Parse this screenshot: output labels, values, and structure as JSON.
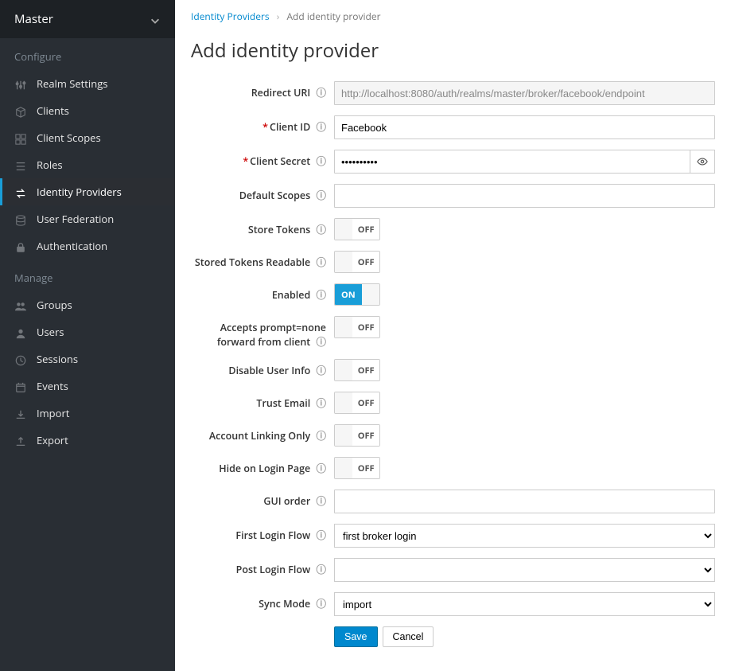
{
  "realm": {
    "name": "Master"
  },
  "sidebar": {
    "sections": [
      {
        "label": "Configure",
        "items": [
          {
            "label": "Realm Settings",
            "icon": "sliders"
          },
          {
            "label": "Clients",
            "icon": "cube"
          },
          {
            "label": "Client Scopes",
            "icon": "modules"
          },
          {
            "label": "Roles",
            "icon": "list"
          },
          {
            "label": "Identity Providers",
            "icon": "swap",
            "active": true
          },
          {
            "label": "User Federation",
            "icon": "database"
          },
          {
            "label": "Authentication",
            "icon": "lock"
          }
        ]
      },
      {
        "label": "Manage",
        "items": [
          {
            "label": "Groups",
            "icon": "users"
          },
          {
            "label": "Users",
            "icon": "user"
          },
          {
            "label": "Sessions",
            "icon": "clock"
          },
          {
            "label": "Events",
            "icon": "calendar"
          },
          {
            "label": "Import",
            "icon": "import"
          },
          {
            "label": "Export",
            "icon": "export"
          }
        ]
      }
    ]
  },
  "breadcrumb": {
    "parent": "Identity Providers",
    "current": "Add identity provider"
  },
  "page": {
    "title": "Add identity provider"
  },
  "form": {
    "redirect_uri": {
      "label": "Redirect URI",
      "value": "http://localhost:8080/auth/realms/master/broker/facebook/endpoint"
    },
    "client_id": {
      "label": "Client ID",
      "value": "Facebook",
      "required": true
    },
    "client_secret": {
      "label": "Client Secret",
      "value": "••••••••••",
      "required": true
    },
    "default_scopes": {
      "label": "Default Scopes",
      "value": ""
    },
    "store_tokens": {
      "label": "Store Tokens",
      "on": false
    },
    "stored_tokens_readable": {
      "label": "Stored Tokens Readable",
      "on": false
    },
    "enabled": {
      "label": "Enabled",
      "on": true
    },
    "accepts_prompt_none": {
      "label": "Accepts prompt=none forward from client",
      "on": false
    },
    "disable_user_info": {
      "label": "Disable User Info",
      "on": false
    },
    "trust_email": {
      "label": "Trust Email",
      "on": false
    },
    "account_linking_only": {
      "label": "Account Linking Only",
      "on": false
    },
    "hide_on_login_page": {
      "label": "Hide on Login Page",
      "on": false
    },
    "gui_order": {
      "label": "GUI order",
      "value": ""
    },
    "first_login_flow": {
      "label": "First Login Flow",
      "value": "first broker login"
    },
    "post_login_flow": {
      "label": "Post Login Flow",
      "value": ""
    },
    "sync_mode": {
      "label": "Sync Mode",
      "value": "import"
    }
  },
  "toggle_text": {
    "on": "ON",
    "off": "OFF"
  },
  "buttons": {
    "save": "Save",
    "cancel": "Cancel"
  }
}
